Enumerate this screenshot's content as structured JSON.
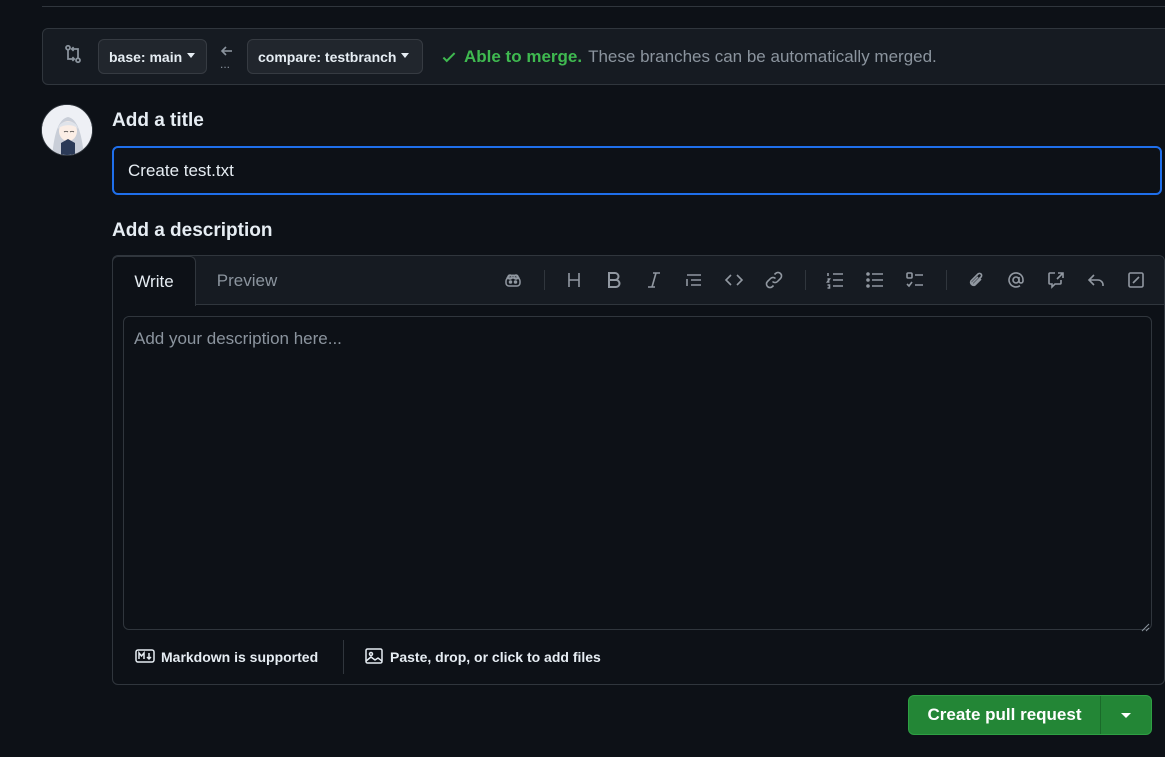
{
  "compare_bar": {
    "base_label": "base: main",
    "compare_label": "compare: testbranch",
    "dots": "...",
    "merge_ok": "Able to merge.",
    "merge_msg": "These branches can be automatically merged."
  },
  "form": {
    "title_heading": "Add a title",
    "title_value": "Create test.txt",
    "description_heading": "Add a description",
    "description_placeholder": "Add your description here..."
  },
  "editor": {
    "tabs": [
      {
        "label": "Write",
        "active": true
      },
      {
        "label": "Preview",
        "active": false
      }
    ],
    "toolbar": [
      "copilot-icon",
      "heading-icon",
      "bold-icon",
      "italic-icon",
      "quote-icon",
      "code-icon",
      "link-icon",
      "ordered-list-icon",
      "unordered-list-icon",
      "task-list-icon",
      "attach-icon",
      "mention-icon",
      "reference-icon",
      "reply-icon",
      "slash-command-icon"
    ],
    "footer_markdown": "Markdown is supported",
    "footer_files": "Paste, drop, or click to add files"
  },
  "actions": {
    "create_label": "Create pull request"
  },
  "colors": {
    "accent_blue": "#1f6feb",
    "success_green": "#3fb950",
    "button_green": "#238636",
    "background": "#0d1117"
  }
}
